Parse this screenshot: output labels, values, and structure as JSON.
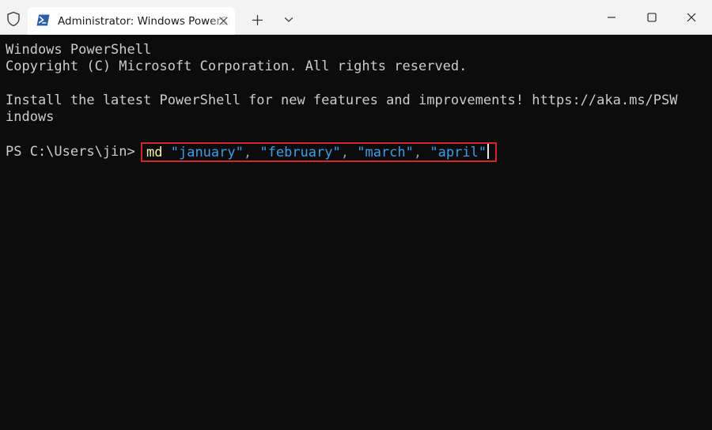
{
  "titlebar": {
    "tab_title": "Administrator: Windows PowerShell",
    "icons": {
      "shield": "shield-icon",
      "powershell": "powershell-icon",
      "tab_close": "close-icon",
      "new_tab": "plus-icon",
      "dropdown": "chevron-down-icon",
      "minimize": "minimize-icon",
      "maximize": "maximize-icon",
      "close": "close-icon"
    }
  },
  "terminal": {
    "line1": "Windows PowerShell",
    "line2": "Copyright (C) Microsoft Corporation. All rights reserved.",
    "line3": "Install the latest PowerShell for new features and improvements! https://aka.ms/PSW",
    "line4": "indows",
    "prompt": "PS C:\\Users\\jin>",
    "command": {
      "name": "md",
      "arg1": "\"january\"",
      "sep1": ",",
      "arg2": "\"february\"",
      "sep2": ",",
      "arg3": "\"march\"",
      "sep3": ",",
      "arg4": "\"april\""
    }
  },
  "colors": {
    "terminal_bg": "#0c0c0c",
    "terminal_text": "#cccccc",
    "command_color": "#f9f1a5",
    "string_color": "#3b9fe8",
    "highlight_border": "#d4262b",
    "titlebar_bg": "#f3f3f3",
    "tab_bg": "#ffffff"
  }
}
